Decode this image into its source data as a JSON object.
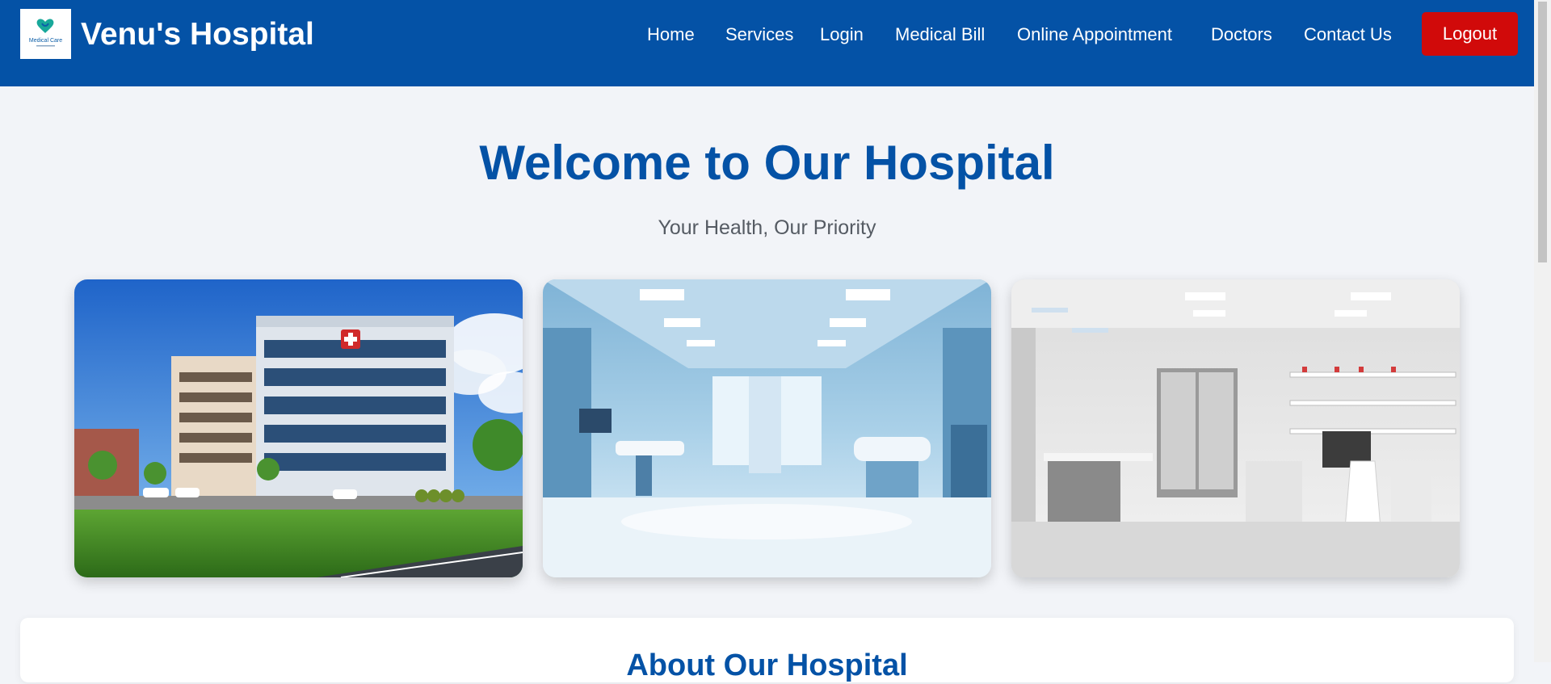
{
  "app": {
    "brand_name": "Venu's Hospital",
    "logo_text": "Medical Care"
  },
  "nav": {
    "items": [
      {
        "label": "Home"
      },
      {
        "label": "Services"
      },
      {
        "label": "Login"
      },
      {
        "label": "Medical Bill"
      },
      {
        "label": "Online Appointment"
      },
      {
        "label": "Doctors"
      },
      {
        "label": "Contact Us"
      }
    ],
    "logout_label": "Logout"
  },
  "hero": {
    "title": "Welcome to Our Hospital",
    "subtitle": "Your Health, Our Priority"
  },
  "gallery": [
    {
      "subject": "hospital-building"
    },
    {
      "subject": "operating-room"
    },
    {
      "subject": "laboratory"
    }
  ],
  "about": {
    "title": "About Our Hospital"
  },
  "colors": {
    "primary": "#0452a6",
    "logout": "#d10a0a",
    "background": "#f2f4f8",
    "subtitle": "#555b63"
  },
  "icons": [
    "hospital-logo-icon"
  ]
}
